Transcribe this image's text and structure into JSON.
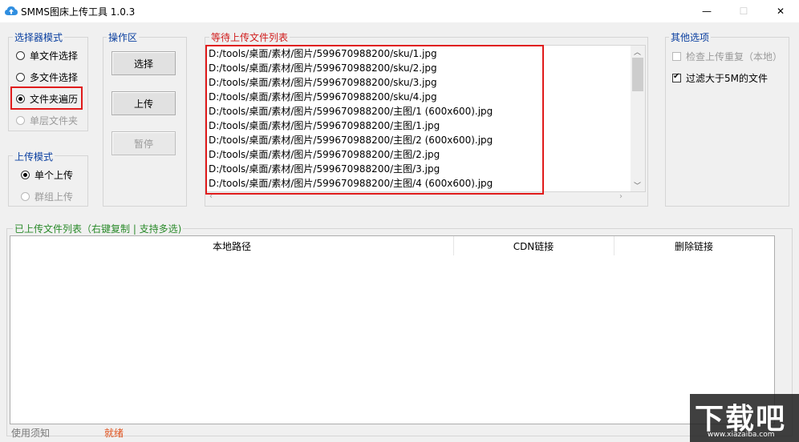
{
  "window": {
    "title": "SMMS图床上传工具 1.0.3",
    "min_glyph": "—",
    "max_glyph": "☐",
    "close_glyph": "✕"
  },
  "selector_mode": {
    "title": "选择器模式",
    "options": [
      {
        "label": "单文件选择",
        "checked": false,
        "disabled": false
      },
      {
        "label": "多文件选择",
        "checked": false,
        "disabled": false
      },
      {
        "label": "文件夹遍历",
        "checked": true,
        "disabled": false
      },
      {
        "label": "单层文件夹",
        "checked": false,
        "disabled": true
      }
    ]
  },
  "upload_mode": {
    "title": "上传模式",
    "options": [
      {
        "label": "单个上传",
        "checked": true,
        "disabled": false
      },
      {
        "label": "群组上传",
        "checked": false,
        "disabled": true
      }
    ]
  },
  "operations": {
    "title": "操作区",
    "select_label": "选择",
    "upload_label": "上传",
    "pause_label": "暂停"
  },
  "pending": {
    "title": "等待上传文件列表",
    "files": [
      "D:/tools/桌面/素材/图片/599670988200/sku/1.jpg",
      "D:/tools/桌面/素材/图片/599670988200/sku/2.jpg",
      "D:/tools/桌面/素材/图片/599670988200/sku/3.jpg",
      "D:/tools/桌面/素材/图片/599670988200/sku/4.jpg",
      "D:/tools/桌面/素材/图片/599670988200/主图/1 (600x600).jpg",
      "D:/tools/桌面/素材/图片/599670988200/主图/1.jpg",
      "D:/tools/桌面/素材/图片/599670988200/主图/2 (600x600).jpg",
      "D:/tools/桌面/素材/图片/599670988200/主图/2.jpg",
      "D:/tools/桌面/素材/图片/599670988200/主图/3.jpg",
      "D:/tools/桌面/素材/图片/599670988200/主图/4 (600x600).jpg"
    ]
  },
  "other_options": {
    "title": "其他选项",
    "check_duplicate": {
      "label": "检查上传重复（本地）",
      "checked": false,
      "disabled": true
    },
    "filter_large": {
      "label": "过滤大于5M的文件",
      "checked": true,
      "disabled": false
    }
  },
  "uploaded": {
    "title": "已上传文件列表（右键复制 | 支持多选)",
    "columns": [
      "本地路径",
      "CDN链接",
      "删除链接"
    ]
  },
  "status": {
    "help": "使用须知",
    "state": "就绪"
  },
  "watermark": {
    "logo_text": "下载吧",
    "url": "www.xiazaiba.com"
  },
  "colors": {
    "group_title": "#0a3fa0",
    "pending_title": "#d01b1b",
    "uploaded_title": "#2a8a2a",
    "status_state": "#e0501b",
    "highlight": "#e01b1b"
  }
}
